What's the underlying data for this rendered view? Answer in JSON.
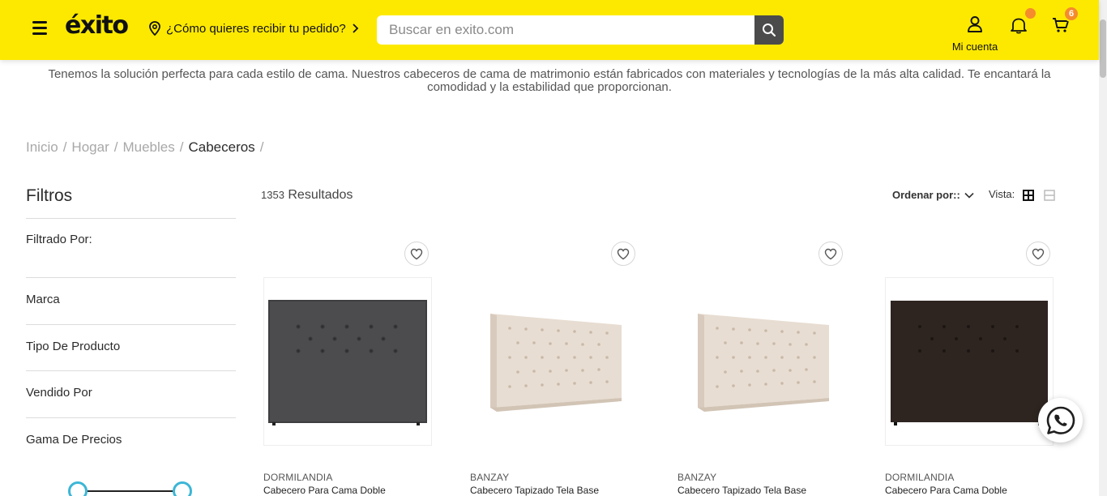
{
  "header": {
    "logo_text": "éxito",
    "location_prompt": "¿Cómo quieres recibir tu pedido?",
    "search_placeholder": "Buscar en exito.com",
    "account_label": "Mi cuenta",
    "cart_count": "6",
    "brand_color": "#fde900",
    "badge_color": "#f58b2c"
  },
  "description": "Tenemos la solución perfecta para cada estilo de cama. Nuestros cabeceros de cama de matrimonio están fabricados con materiales y tecnologías de la más alta calidad. Te encantará la comodidad y la estabilidad que proporcionan.",
  "breadcrumb": {
    "items": [
      "Inicio",
      "Hogar",
      "Muebles",
      "Cabeceros"
    ],
    "separator": "/"
  },
  "sidebar": {
    "title": "Filtros",
    "filtered_by": "Filtrado Por:",
    "facets": [
      "Marca",
      "Tipo De Producto",
      "Vendido Por",
      "Gama De Precios"
    ]
  },
  "results": {
    "count": "1353",
    "label": "Resultados",
    "sort_label": "Ordenar por::",
    "view_label": "Vista:"
  },
  "products": [
    {
      "brand": "DORMILANDIA",
      "name": "Cabecero Para Cama Doble",
      "image": "dark-gray-tufted-headboard"
    },
    {
      "brand": "BANZAY",
      "name": "Cabecero Tapizado Tela Base",
      "image": "beige-capitone-headboard"
    },
    {
      "brand": "BANZAY",
      "name": "Cabecero Tapizado Tela Base",
      "image": "beige-capitone-headboard"
    },
    {
      "brand": "DORMILANDIA",
      "name": "Cabecero Para Cama Doble",
      "image": "dark-brown-tufted-headboard"
    }
  ],
  "icons": {
    "menu": "hamburger-icon",
    "location": "location-pin-icon",
    "search": "search-icon",
    "account": "user-icon",
    "notifications": "bell-icon",
    "cart": "cart-icon",
    "wishlist": "heart-icon",
    "whatsapp": "whatsapp-icon"
  },
  "colors": {
    "header_bg": "#fde900",
    "notification_dot": "#f58b2c",
    "range_knob": "#3cb6d6",
    "headboard_gray": "#4c4c4e",
    "headboard_brown": "#2e2520",
    "headboard_beige": "#e8ddd2"
  }
}
